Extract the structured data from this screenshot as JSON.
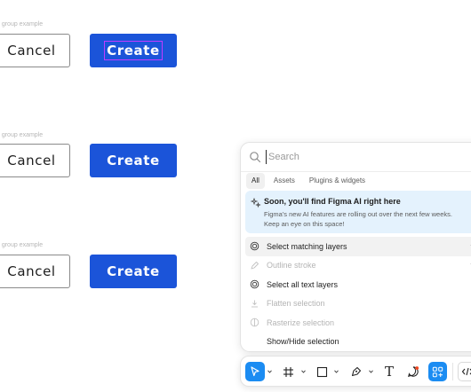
{
  "canvas": {
    "groups": [
      {
        "label": "n group example",
        "cancel_label": "Cancel",
        "create_label": "Create",
        "selected": true
      },
      {
        "label": "n group example",
        "cancel_label": "Cancel",
        "create_label": "Create",
        "selected": false
      },
      {
        "label": "n group example",
        "cancel_label": "Cancel",
        "create_label": "Create",
        "selected": false
      }
    ]
  },
  "quick_actions": {
    "search": {
      "placeholder": "Search",
      "value": ""
    },
    "tabs": [
      {
        "label": "All",
        "active": true
      },
      {
        "label": "Assets",
        "active": false
      },
      {
        "label": "Plugins & widgets",
        "active": false
      }
    ],
    "banner": {
      "title": "Soon, you'll find Figma AI right here",
      "body": "Figma's new AI features are rolling out over the next few weeks. Keep an eye on this space!",
      "icon": "sparkle-icon"
    },
    "items": [
      {
        "label": "Select matching layers",
        "shortcut": "⌥⌘",
        "icon": "target-icon",
        "enabled": true,
        "highlighted": true
      },
      {
        "label": "Outline stroke",
        "shortcut": "⌥⌘",
        "icon": "pen-icon",
        "enabled": false,
        "highlighted": false
      },
      {
        "label": "Select all text layers",
        "shortcut": "",
        "icon": "target-icon",
        "enabled": true,
        "highlighted": false
      },
      {
        "label": "Flatten selection",
        "shortcut": "",
        "icon": "flatten-icon",
        "enabled": false,
        "highlighted": false
      },
      {
        "label": "Rasterize selection",
        "shortcut": "",
        "icon": "rasterize-icon",
        "enabled": false,
        "highlighted": false
      },
      {
        "label": "Show/Hide selection",
        "shortcut": "⇧⌘",
        "icon": "",
        "enabled": true,
        "highlighted": false
      }
    ]
  },
  "toolbar": {
    "tools": [
      {
        "name": "move-tool",
        "icon": "cursor-icon",
        "active": true
      },
      {
        "name": "frame-tool",
        "icon": "frame-icon",
        "active": false
      },
      {
        "name": "shape-tool",
        "icon": "rectangle-icon",
        "active": false
      },
      {
        "name": "pen-tool",
        "icon": "pen-icon",
        "active": false
      },
      {
        "name": "text-tool",
        "icon": "text-icon",
        "active": false
      },
      {
        "name": "comment-tool",
        "icon": "comment-icon",
        "active": false
      },
      {
        "name": "actions-tool",
        "icon": "actions-icon",
        "active": true
      },
      {
        "name": "dev-mode-toggle",
        "icon": "code-icon",
        "active": false
      }
    ],
    "text_tool_glyph": "T"
  },
  "colors": {
    "primary": "#1b54d9",
    "accent": "#1b8cf2",
    "banner_bg": "#e4f2fd",
    "selection_outline": "#c13bff"
  }
}
